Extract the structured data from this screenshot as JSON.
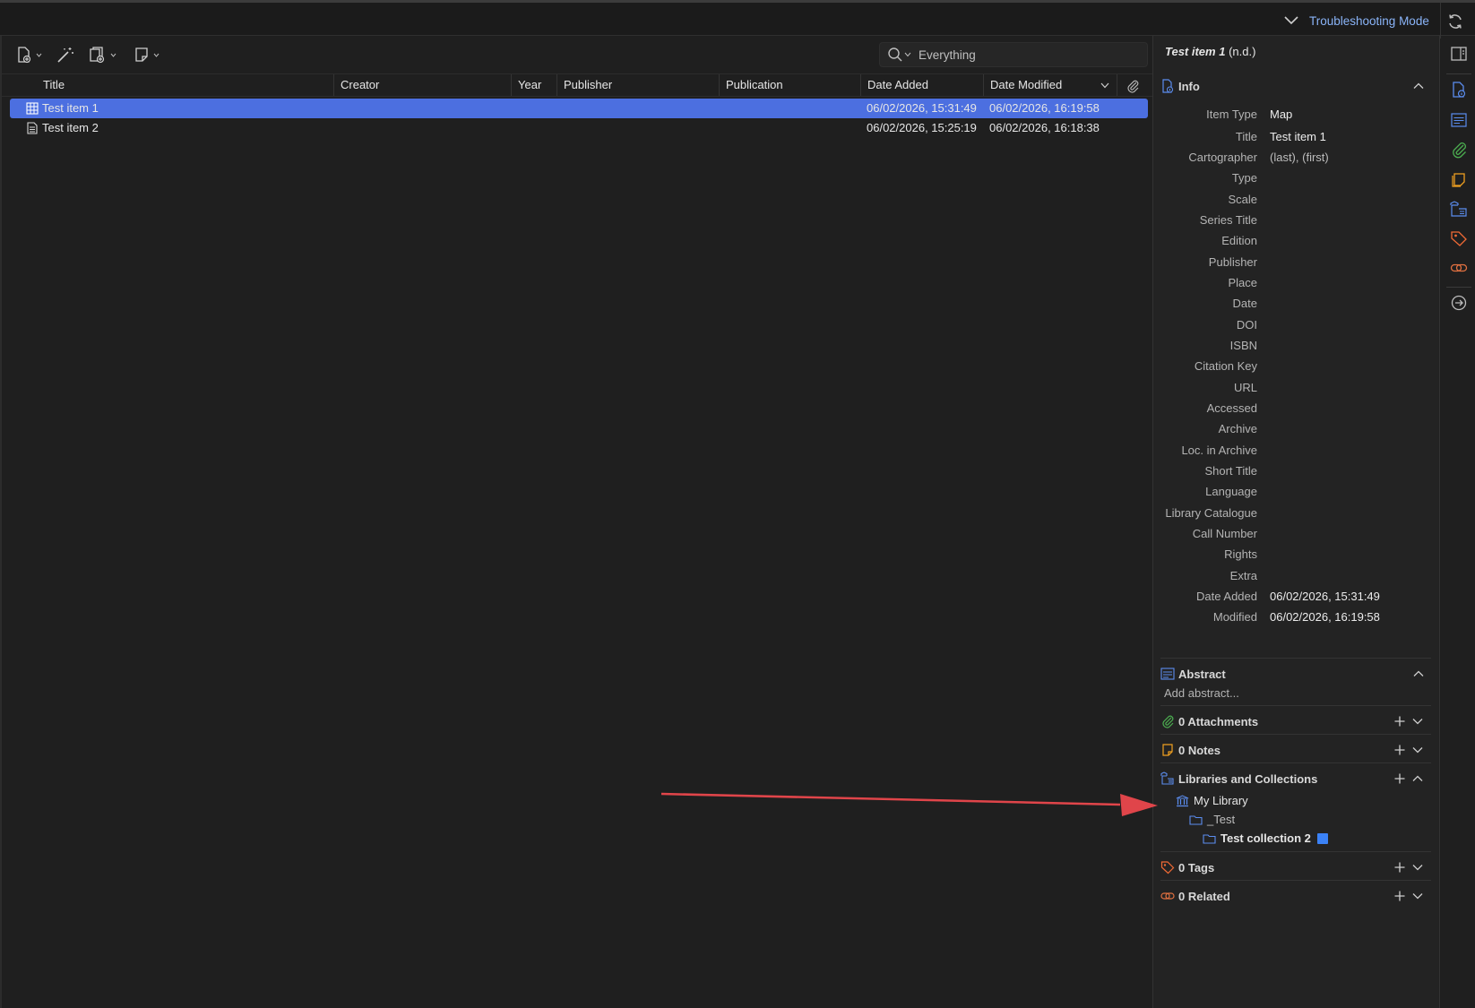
{
  "topbar": {
    "troubleshooting_label": "Troubleshooting Mode"
  },
  "search": {
    "placeholder": "Everything"
  },
  "columns": {
    "title": "Title",
    "creator": "Creator",
    "year": "Year",
    "publisher": "Publisher",
    "publication": "Publication",
    "date_added": "Date Added",
    "date_modified": "Date Modified"
  },
  "items": [
    {
      "title": "Test item 1",
      "date_added": "06/02/2026, 15:31:49",
      "date_modified": "06/02/2026, 16:19:58",
      "icon": "map-icon",
      "selected": true
    },
    {
      "title": "Test item 2",
      "date_added": "06/02/2026, 15:25:19",
      "date_modified": "06/02/2026, 16:18:38",
      "icon": "document-icon",
      "selected": false
    }
  ],
  "item_pane": {
    "header_title": "Test item 1",
    "header_suffix": "(n.d.)",
    "info": {
      "heading": "Info",
      "fields": {
        "item_type_label": "Item Type",
        "item_type_value": "Map",
        "title_label": "Title",
        "title_value": "Test item 1",
        "cartographer_label": "Cartographer",
        "cartographer_last": "(last)",
        "cartographer_first": "(first)",
        "type_label": "Type",
        "scale_label": "Scale",
        "series_title_label": "Series Title",
        "edition_label": "Edition",
        "publisher_label": "Publisher",
        "place_label": "Place",
        "date_label": "Date",
        "doi_label": "DOI",
        "isbn_label": "ISBN",
        "citation_key_label": "Citation Key",
        "url_label": "URL",
        "accessed_label": "Accessed",
        "archive_label": "Archive",
        "loc_archive_label": "Loc. in Archive",
        "short_title_label": "Short Title",
        "language_label": "Language",
        "library_catalogue_label": "Library Catalogue",
        "call_number_label": "Call Number",
        "rights_label": "Rights",
        "extra_label": "Extra",
        "date_added_label": "Date Added",
        "date_added_value": "06/02/2026, 15:31:49",
        "modified_label": "Modified",
        "modified_value": "06/02/2026, 16:19:58"
      }
    },
    "abstract": {
      "heading": "Abstract",
      "placeholder": "Add abstract..."
    },
    "attachments": {
      "heading": "0 Attachments"
    },
    "notes": {
      "heading": "0 Notes"
    },
    "libraries": {
      "heading": "Libraries and Collections",
      "library": "My Library",
      "collection_parent": "_Test",
      "collection_child": "Test collection 2",
      "collection_color": "#3b82f6"
    },
    "tags": {
      "heading": "0 Tags"
    },
    "related": {
      "heading": "0 Related"
    }
  },
  "colors": {
    "accent": "#8ab4f8",
    "selection": "#4c6fe0",
    "annotation_arrow": "#e0454a"
  }
}
